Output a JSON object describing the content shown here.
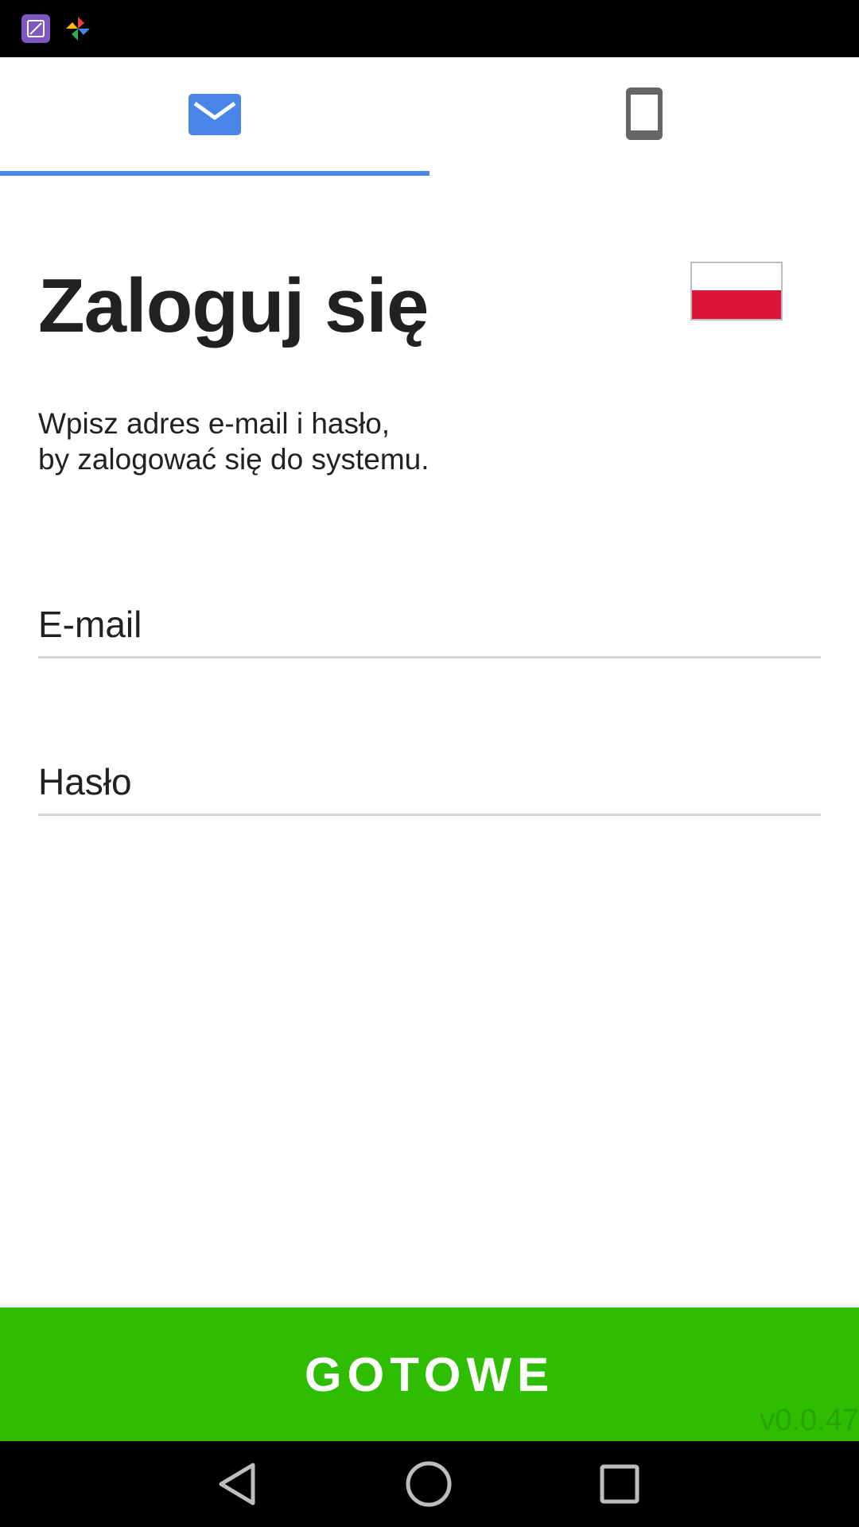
{
  "status_bar": {
    "icons": [
      "gallery-app-icon",
      "pinwheel-app-icon"
    ]
  },
  "tabs": [
    {
      "name": "email-tab",
      "icon": "mail-icon",
      "selected": true,
      "color": "#4a86e8"
    },
    {
      "name": "phone-tab",
      "icon": "smartphone-icon",
      "selected": false,
      "color": "#666666"
    }
  ],
  "login": {
    "title": "Zaloguj się",
    "subtitle_line1": "Wpisz adres e-mail i hasło,",
    "subtitle_line2": "by zalogować się do systemu.",
    "language_flag": "poland-flag-icon"
  },
  "form": {
    "email_placeholder": "E-mail",
    "email_value": "",
    "password_placeholder": "Hasło",
    "password_value": ""
  },
  "submit": {
    "label": "GOTOWE",
    "color": "#2ebd00"
  },
  "version": "v0.0.47",
  "nav_bar": {
    "buttons": [
      "back-icon",
      "home-icon",
      "recents-icon"
    ]
  }
}
